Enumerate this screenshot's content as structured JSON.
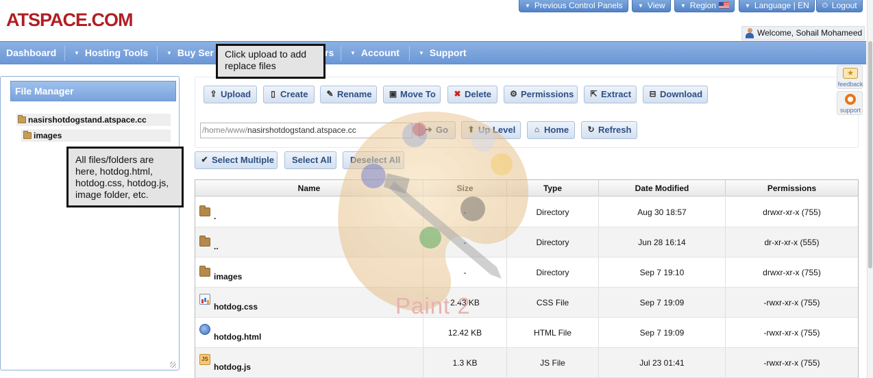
{
  "brand": {
    "logo_text": "ATSPACE.COM"
  },
  "top_buttons": [
    {
      "label": "Previous Control Panels",
      "icon": "caret-down-icon"
    },
    {
      "label": "View",
      "icon": "caret-down-icon"
    },
    {
      "label": "Region",
      "icon": "caret-down-icon",
      "flag": "us-flag-icon"
    },
    {
      "label": "Language | EN",
      "icon": "caret-down-icon"
    },
    {
      "label": "Logout",
      "icon": "power-icon"
    }
  ],
  "welcome": {
    "text": "Welcome, Sohail Mohameed"
  },
  "nav": [
    {
      "label": "Dashboard"
    },
    {
      "label": "Hosting Tools"
    },
    {
      "label": "Buy Ser"
    },
    {
      "label": "rs"
    },
    {
      "label": "Account"
    },
    {
      "label": "Support"
    }
  ],
  "annotations": {
    "upload_tip": "Click upload to add replace files",
    "files_tip": "All files/folders are here, hotdog.html, hotdog.css,  hotdog.js, image folder, etc."
  },
  "file_manager": {
    "title": "File Manager",
    "tree": [
      {
        "label": "nasirshotdogstand.atspace.cc"
      },
      {
        "label": "images"
      }
    ]
  },
  "toolbar": {
    "buttons": [
      {
        "label": "Upload",
        "icon": "upload-icon"
      },
      {
        "label": "Create",
        "icon": "create-icon"
      },
      {
        "label": "Rename",
        "icon": "rename-icon"
      },
      {
        "label": "Move To",
        "icon": "move-icon"
      },
      {
        "label": "Delete",
        "icon": "delete-icon"
      },
      {
        "label": "Permissions",
        "icon": "gear-icon"
      },
      {
        "label": "Extract",
        "icon": "extract-icon"
      },
      {
        "label": "Download",
        "icon": "download-icon"
      }
    ]
  },
  "path": {
    "prefix": "/home/www/",
    "value": "nasirshotdogstand.atspace.cc",
    "go_label": "Go",
    "up_label": "Up Level",
    "home_label": "Home",
    "refresh_label": "Refresh"
  },
  "selection": {
    "select_multiple": "Select Multiple",
    "select_all": "Select All",
    "deselect_all": "Deselect All"
  },
  "table": {
    "headers": [
      "Name",
      "Size",
      "Type",
      "Date Modified",
      "Permissions"
    ],
    "rows": [
      {
        "name": ".",
        "size": "-",
        "type": "Directory",
        "date": "Aug 30 18:57",
        "perm": "drwxr-xr-x (755)",
        "icon": "folder-icon"
      },
      {
        "name": "..",
        "size": "-",
        "type": "Directory",
        "date": "Jun 28 16:14",
        "perm": "dr-xr-xr-x (555)",
        "icon": "folder-icon"
      },
      {
        "name": "images",
        "size": "-",
        "type": "Directory",
        "date": "Sep 7 19:10",
        "perm": "drwxr-xr-x (755)",
        "icon": "folder-icon"
      },
      {
        "name": "hotdog.css",
        "size": "2.43 KB",
        "type": "CSS File",
        "date": "Sep 7 19:09",
        "perm": "-rwxr-xr-x (755)",
        "icon": "css-file-icon"
      },
      {
        "name": "hotdog.html",
        "size": "12.42 KB",
        "type": "HTML File",
        "date": "Sep 7 19:09",
        "perm": "-rwxr-xr-x (755)",
        "icon": "html-file-icon"
      },
      {
        "name": "hotdog.js",
        "size": "1.3 KB",
        "type": "JS File",
        "date": "Jul 23 01:41",
        "perm": "-rwxr-xr-x (755)",
        "icon": "js-file-icon"
      }
    ]
  },
  "side_widgets": [
    {
      "label": "feedback",
      "icon": "feedback-star-icon"
    },
    {
      "label": "support",
      "icon": "lifebuoy-icon"
    }
  ],
  "watermark": {
    "text": "Paint 2",
    "icon": "paint-palette-icon"
  }
}
